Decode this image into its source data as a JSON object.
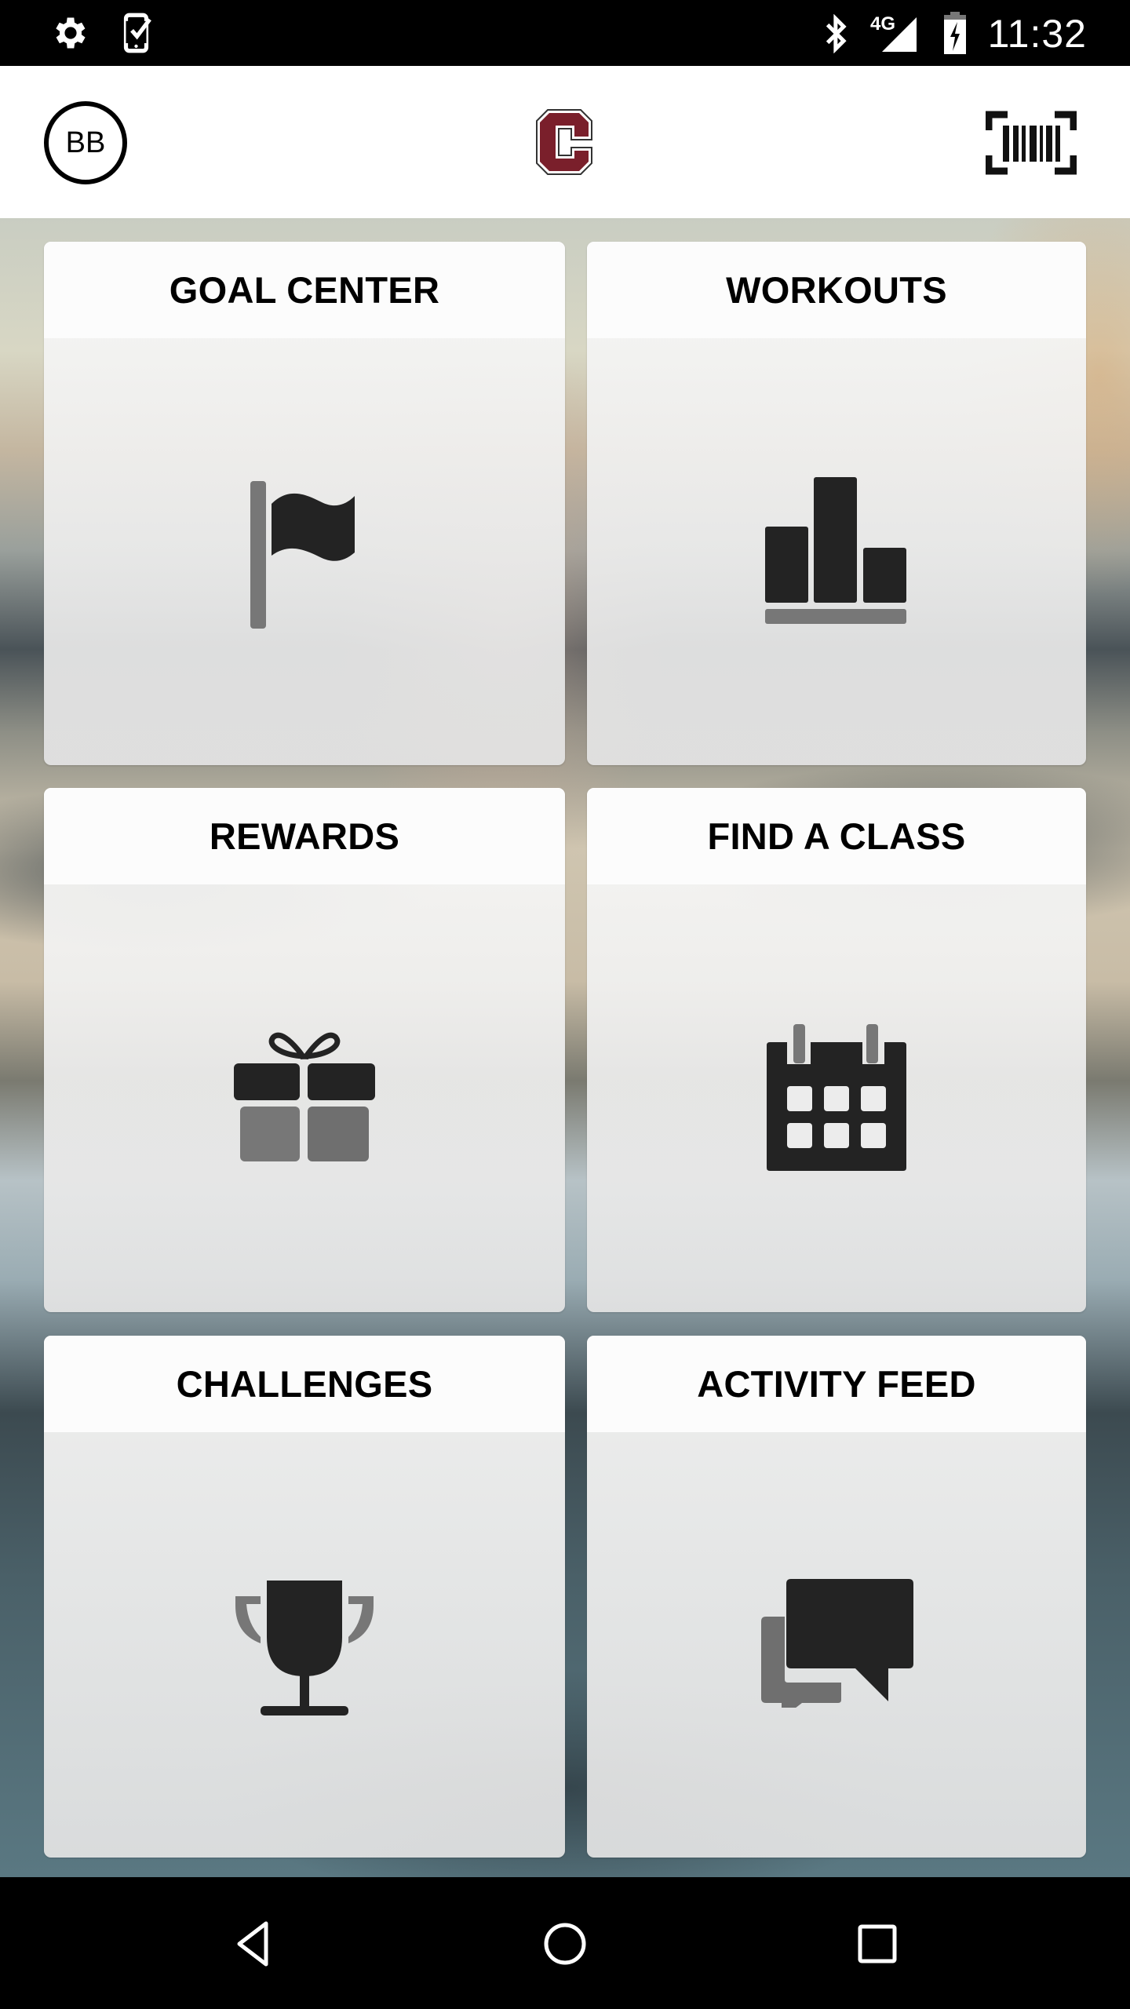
{
  "status_bar": {
    "left_icons": [
      "settings-icon",
      "device-check-icon"
    ],
    "right_icons": [
      "bluetooth-icon",
      "signal-4g-icon",
      "battery-charging-icon"
    ],
    "network_label": "4G",
    "time": "11:32"
  },
  "header": {
    "avatar_initials": "BB",
    "logo": "maroon-c-logo",
    "logo_color": "#7a1f2b",
    "scan_icon": "barcode-scan-icon"
  },
  "tiles": [
    {
      "label": "GOAL CENTER",
      "icon": "flag-icon"
    },
    {
      "label": "WORKOUTS",
      "icon": "bar-chart-icon"
    },
    {
      "label": "REWARDS",
      "icon": "gift-icon"
    },
    {
      "label": "FIND A CLASS",
      "icon": "calendar-icon"
    },
    {
      "label": "CHALLENGES",
      "icon": "trophy-icon"
    },
    {
      "label": "ACTIVITY FEED",
      "icon": "chat-bubbles-icon"
    }
  ],
  "colors": {
    "icon_dark": "#232323",
    "icon_gray": "#777777",
    "tile_header": "#fcfcfc"
  },
  "nav_bar": {
    "buttons": [
      "back",
      "home",
      "recents"
    ]
  }
}
